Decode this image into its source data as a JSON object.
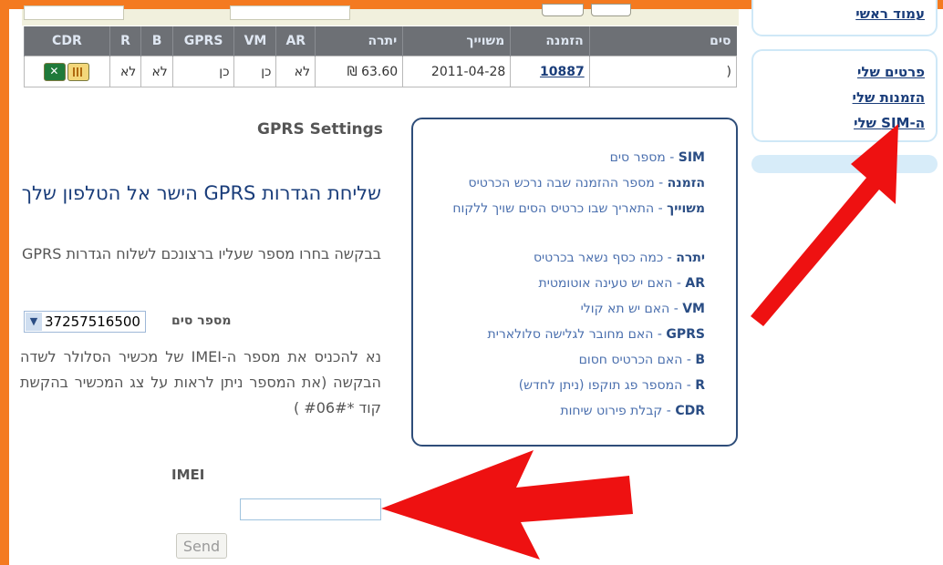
{
  "table": {
    "headers": [
      "סים",
      "הזמנה",
      "משוייך",
      "יתרה",
      "AR",
      "VM",
      "GPRS",
      "B",
      "R",
      "CDR"
    ],
    "row": {
      "sim": "(",
      "order": "10887",
      "assigned": "2011-04-28",
      "balance": "63.60 ₪",
      "ar": "לא",
      "vm": "כן",
      "gprs": "כן",
      "b": "לא",
      "r": "לא"
    }
  },
  "nav": {
    "home": "עמוד ראשי",
    "my_details": "פרטים שלי",
    "my_orders": "הזמנות שלי",
    "my_sims": "ה-SIM שלי"
  },
  "form": {
    "title": "GPRS Settings",
    "heading": "שליחת הגדרות GPRS הישר אל הטלפון שלך",
    "instruction": "בבקשה בחרו מספר שעליו ברצונכם לשלוח הגדרות GPRS",
    "sim_label": "מספר סים",
    "sim_value": "37257516500",
    "imei_help": "נא להכניס את מספר ה-IMEI של מכשיר הסלולר לשדה הבקשה (את המספר ניתן לראות על צג המכשיר בהקשת קוד *#06# )",
    "imei_label": "IMEI",
    "imei_value": "",
    "send_label": "Send"
  },
  "legend": [
    {
      "key": "SIM",
      "desc": " - מספר סים"
    },
    {
      "key": "הזמנה",
      "desc": " - מספר ההזמנה שבה נרכש הכרטיס"
    },
    {
      "key": "משוייך",
      "desc": " - התאריך שבו כרטיס הסים שויך ללקוח"
    },
    {
      "key": "יתרה",
      "desc": " - כמה כסף נשאר בכרטיס"
    },
    {
      "key": "AR",
      "desc": " - האם יש טעינה אוטומטית"
    },
    {
      "key": "VM",
      "desc": " - האם יש תא קולי"
    },
    {
      "key": "GPRS",
      "desc": " - האם מחובר לגלישה סלולארית"
    },
    {
      "key": "B",
      "desc": " - האם הכרטיס חסום"
    },
    {
      "key": "R",
      "desc": " - המספר פג תוקפו (ניתן לחדש)"
    },
    {
      "key": "CDR",
      "desc": " - קבלת פירוט שיחות"
    }
  ],
  "icons": [
    "excel-icon",
    "calendar-icon"
  ],
  "colors": {
    "frame": "#f47a20",
    "link": "#1a3d7a",
    "header_bg": "#6d7075",
    "arrow": "#ee1111"
  }
}
